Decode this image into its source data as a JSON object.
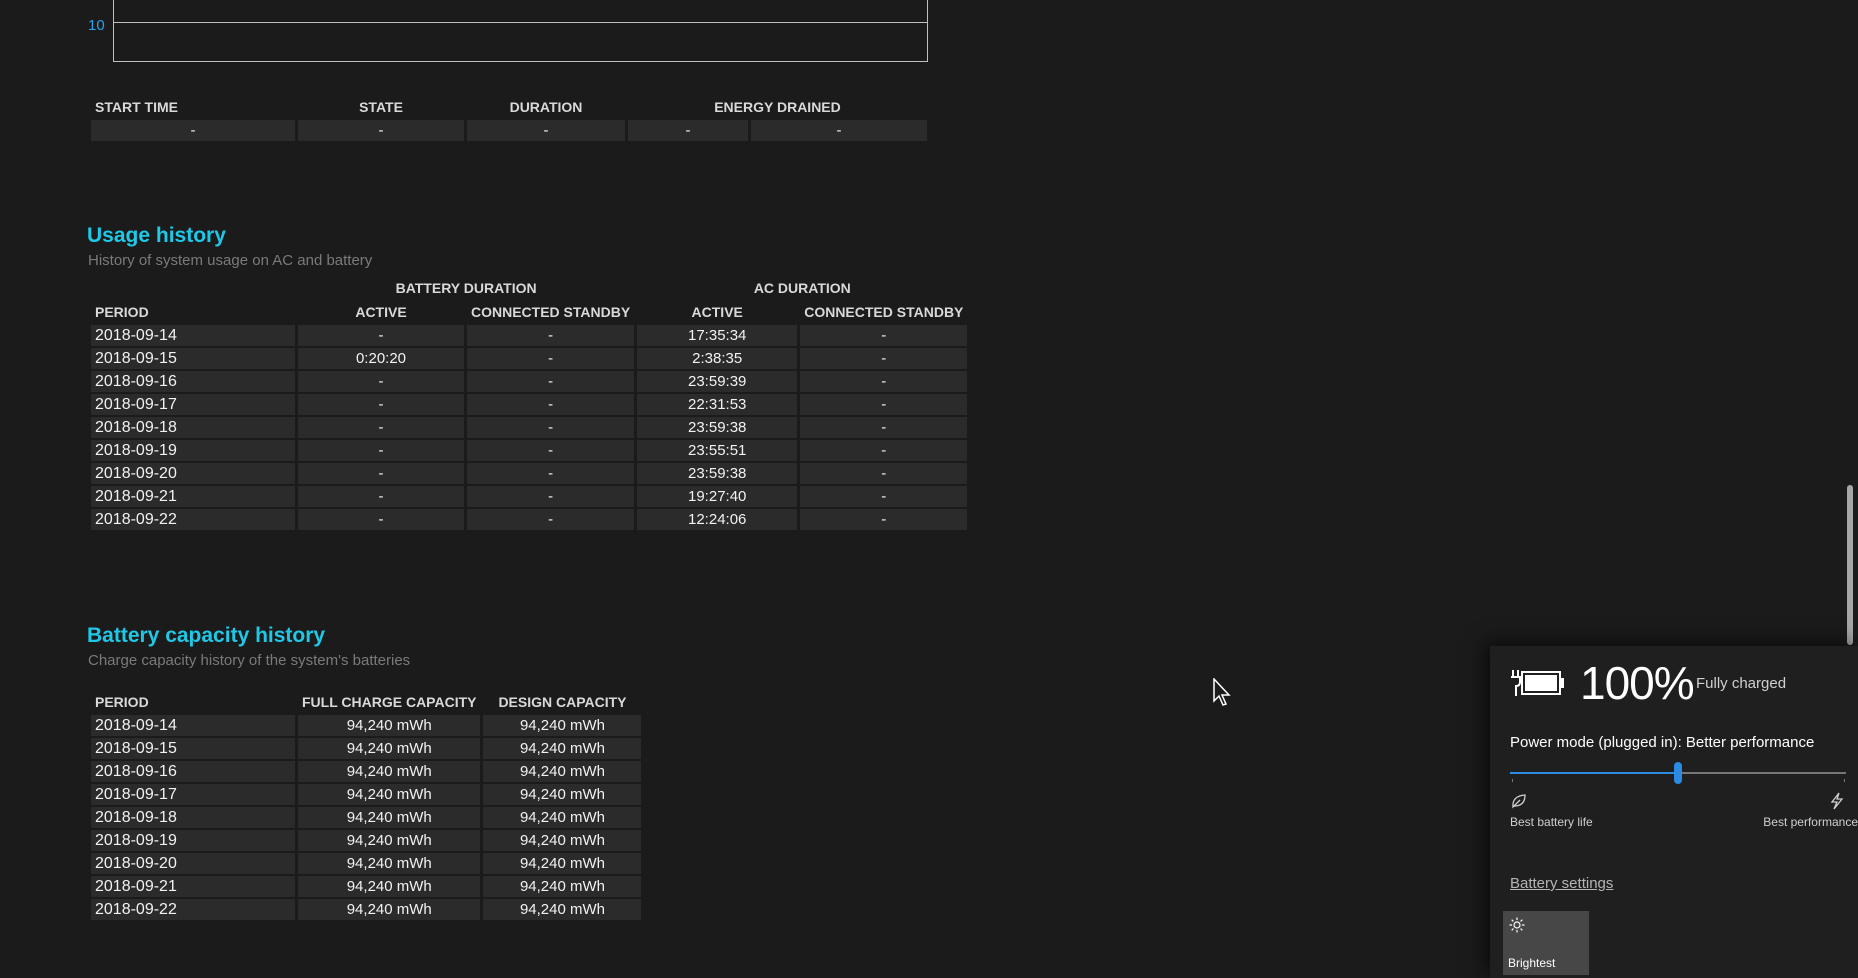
{
  "battery_chart": {
    "tick_label": "10"
  },
  "drain_table": {
    "headers": [
      "START TIME",
      "STATE",
      "DURATION",
      "ENERGY DRAINED"
    ],
    "row": [
      "-",
      "-",
      "-",
      "-",
      "-"
    ]
  },
  "usage_history": {
    "title": "Usage history",
    "subtitle": "History of system usage on AC and battery",
    "group_headers": {
      "battery": "BATTERY DURATION",
      "ac": "AC DURATION"
    },
    "columns": {
      "period": "PERIOD",
      "bat_active": "ACTIVE",
      "bat_standby": "CONNECTED STANDBY",
      "ac_active": "ACTIVE",
      "ac_standby": "CONNECTED STANDBY"
    },
    "rows": [
      [
        "2018-09-14",
        "-",
        "-",
        "17:35:34",
        "-"
      ],
      [
        "2018-09-15",
        "0:20:20",
        "-",
        "2:38:35",
        "-"
      ],
      [
        "2018-09-16",
        "-",
        "-",
        "23:59:39",
        "-"
      ],
      [
        "2018-09-17",
        "-",
        "-",
        "22:31:53",
        "-"
      ],
      [
        "2018-09-18",
        "-",
        "-",
        "23:59:38",
        "-"
      ],
      [
        "2018-09-19",
        "-",
        "-",
        "23:55:51",
        "-"
      ],
      [
        "2018-09-20",
        "-",
        "-",
        "23:59:38",
        "-"
      ],
      [
        "2018-09-21",
        "-",
        "-",
        "19:27:40",
        "-"
      ],
      [
        "2018-09-22",
        "-",
        "-",
        "12:24:06",
        "-"
      ]
    ]
  },
  "capacity_history": {
    "title": "Battery capacity history",
    "subtitle": "Charge capacity history of the system's batteries",
    "columns": {
      "period": "PERIOD",
      "full": "FULL CHARGE CAPACITY",
      "design": "DESIGN CAPACITY"
    },
    "rows": [
      [
        "2018-09-14",
        "94,240 mWh",
        "94,240 mWh"
      ],
      [
        "2018-09-15",
        "94,240 mWh",
        "94,240 mWh"
      ],
      [
        "2018-09-16",
        "94,240 mWh",
        "94,240 mWh"
      ],
      [
        "2018-09-17",
        "94,240 mWh",
        "94,240 mWh"
      ],
      [
        "2018-09-18",
        "94,240 mWh",
        "94,240 mWh"
      ],
      [
        "2018-09-19",
        "94,240 mWh",
        "94,240 mWh"
      ],
      [
        "2018-09-20",
        "94,240 mWh",
        "94,240 mWh"
      ],
      [
        "2018-09-21",
        "94,240 mWh",
        "94,240 mWh"
      ],
      [
        "2018-09-22",
        "94,240 mWh",
        "94,240 mWh"
      ]
    ]
  },
  "flyout": {
    "percent": "100%",
    "status": "Fully charged",
    "power_mode": "Power mode (plugged in): Better performance",
    "slider_level": 0.5,
    "left_label": "Best battery life",
    "right_label": "Best performance",
    "settings_link": "Battery settings",
    "brightness_tile": "Brightest",
    "icons": {
      "battery": "battery-charging-icon",
      "left": "leaf-icon",
      "right": "lightning-icon",
      "tile": "sun-icon"
    }
  },
  "colors": {
    "accent": "#1ec8e6",
    "slider": "#2b8ae2",
    "tick": "#2ba0e8",
    "background": "#1b1b1b",
    "cell": "#2b2b2b"
  }
}
